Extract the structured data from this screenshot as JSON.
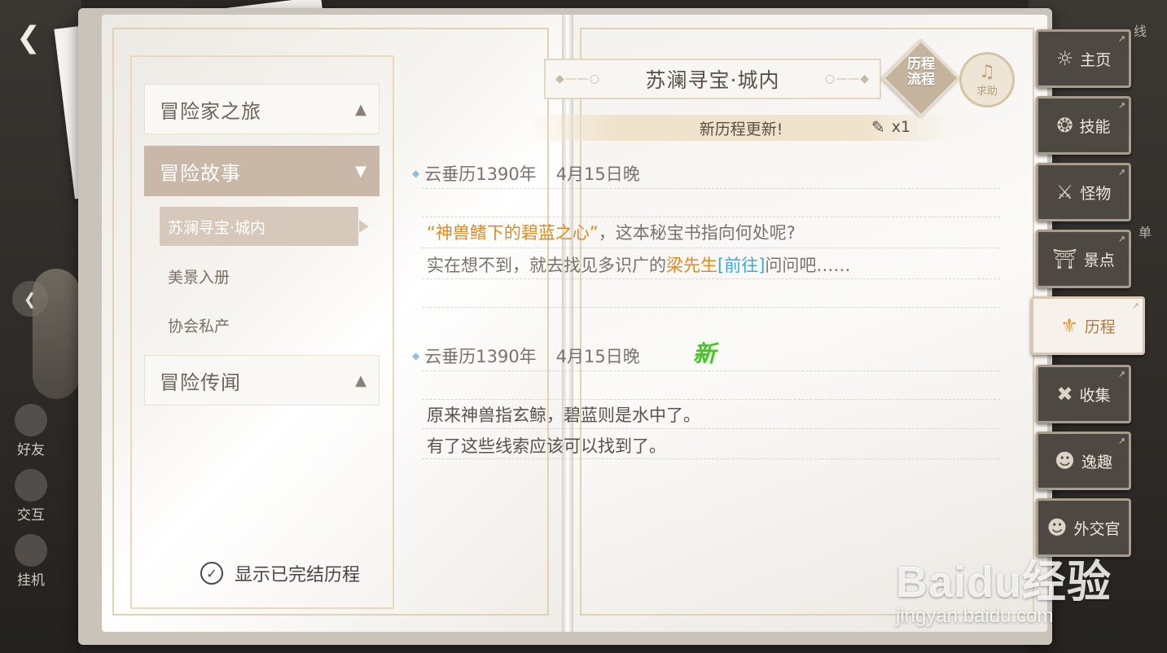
{
  "header": {
    "back_icon": "back-arrow-icon"
  },
  "left_dock": {
    "friends_label": "好友",
    "interact_label": "交互",
    "idle_label": "挂机"
  },
  "nav": {
    "categories": [
      {
        "label": "冒险家之旅",
        "expanded": false
      },
      {
        "label": "冒险故事",
        "expanded": true
      },
      {
        "label": "冒险传闻",
        "expanded": false
      }
    ],
    "story_items": [
      {
        "label": "苏澜寻宝·城内",
        "selected": true
      },
      {
        "label": "美景入册",
        "selected": false
      },
      {
        "label": "协会私产",
        "selected": false
      }
    ],
    "show_completed_label": "显示已完结历程",
    "show_completed_checked": true
  },
  "content": {
    "title": "苏澜寻宝·城内",
    "flow_button_label": "历程流程",
    "flow_line1": "历程",
    "flow_line2": "流程",
    "help_button_label": "求助",
    "update_text": "新历程更新!",
    "update_count": "x1",
    "entries": [
      {
        "date": "云垂历1390年",
        "time": "4月15日晚",
        "is_new": false,
        "line1_quote": "“神兽鳍下的碧蓝之心”",
        "line1_rest": "，这本秘宝书指向何处呢?",
        "line2_pre": "实在想不到，就去找见多识广的",
        "line2_npc": "梁先生",
        "line2_link": "[前往]",
        "line2_post": "问问吧……"
      },
      {
        "date": "云垂历1390年",
        "time": "4月15日晚",
        "is_new": true,
        "new_badge": "新",
        "line1": "原来神兽指玄鲸，碧蓝则是水中了。",
        "line2": "有了这些线索应该可以找到了。"
      }
    ]
  },
  "tabs": [
    {
      "label": "主页",
      "icon": "home-icon",
      "active": false
    },
    {
      "label": "技能",
      "icon": "skill-icon",
      "active": false
    },
    {
      "label": "怪物",
      "icon": "monster-icon",
      "active": false
    },
    {
      "label": "景点",
      "icon": "scenery-icon",
      "active": false
    },
    {
      "label": "历程",
      "icon": "journey-icon",
      "active": true
    },
    {
      "label": "收集",
      "icon": "collection-icon",
      "active": false
    },
    {
      "label": "逸趣",
      "icon": "leisure-icon",
      "active": false
    },
    {
      "label": "外交官",
      "icon": "diplomat-icon",
      "active": false
    }
  ],
  "edge_labels": {
    "top": "线",
    "mid": "单"
  },
  "watermark": {
    "brand": "Baidu经验",
    "url": "jingyan.baidu.com"
  },
  "colors": {
    "highlight_orange": "#e08a1e",
    "link_blue": "#3fa9d8",
    "new_green": "#4fbf32",
    "active_nav": "#c9b7a8"
  }
}
